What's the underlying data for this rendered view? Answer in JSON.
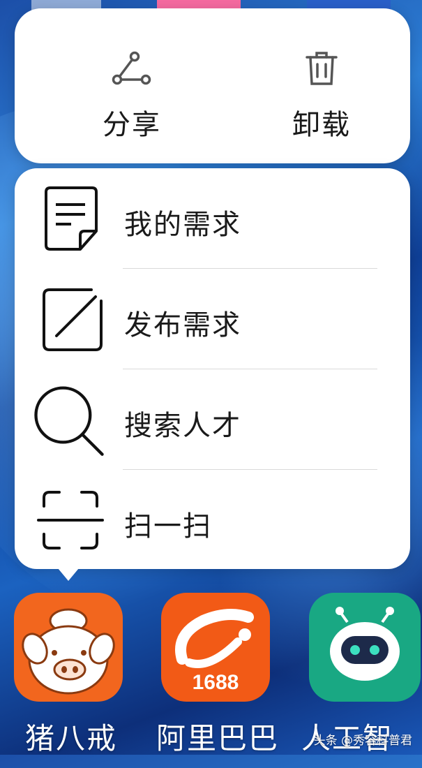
{
  "popup": {
    "share_label": "分享",
    "uninstall_label": "卸载"
  },
  "menu": {
    "items": [
      {
        "label": "我的需求",
        "icon": "document-icon"
      },
      {
        "label": "发布需求",
        "icon": "edit-square-icon"
      },
      {
        "label": "搜索人才",
        "icon": "search-icon"
      },
      {
        "label": "扫一扫",
        "icon": "scan-icon"
      }
    ]
  },
  "dock": {
    "apps": [
      {
        "label": "猪八戒"
      },
      {
        "label": "阿里巴巴"
      },
      {
        "label": "人工智"
      }
    ],
    "alibaba_badge": "1688"
  },
  "watermark": "头条 @秀容科普君",
  "colors": {
    "zhubajie": "#f2661e",
    "alibaba": "#f25a16",
    "ai_app": "#19a883",
    "card": "#ffffff"
  }
}
